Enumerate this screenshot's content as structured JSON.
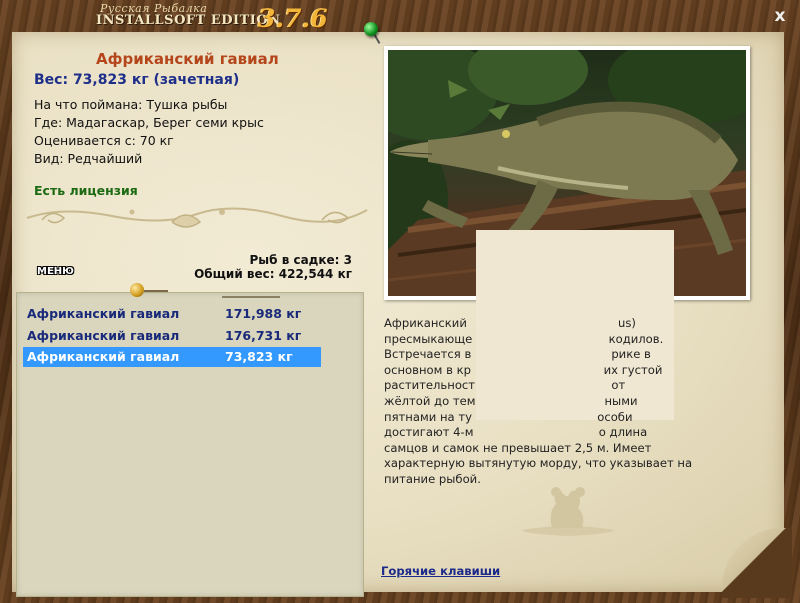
{
  "app": {
    "logo_small": "Русская Рыбалка",
    "logo_main": "INSTALLSOFT EDITION",
    "version": "3.7.6",
    "close_label": "x"
  },
  "fish": {
    "title": "Африканский гавиал",
    "weight": "Вес: 73,823 кг (зачетная)",
    "caught_with": "На что поймана: Тушка рыбы",
    "where": "Где: Мадагаскар, Берег семи крыс",
    "value": "Оценивается с: 70 кг",
    "kind": "Вид: Редчайший",
    "license": "Есть лицензия"
  },
  "stats": {
    "count": "Рыб в садке: 3",
    "total": "Общий вес: 422,544 кг"
  },
  "menu_label": "МЕНЮ",
  "list": [
    {
      "name": "Африканский гавиал",
      "weight": "171,988 кг",
      "selected": false
    },
    {
      "name": "Африканский гавиал",
      "weight": "176,731 кг",
      "selected": false
    },
    {
      "name": "Африканский гавиал",
      "weight": "73,823 кг",
      "selected": true
    }
  ],
  "description": [
    "Африканский                                         us)",
    "пресмыкающе                                     кодилов.",
    "Встречается в                                      рике в",
    "основном в кр                                    их густой",
    "растительност                                     от",
    "жёлтой до тем                                   ными",
    "пятнами на ту                                  особи",
    "достигают 4-м                                  о длина",
    "самцов и самок не превышает 2,5 м. Имеет",
    "характерную вытянутую морду, что указывает на",
    "питание рыбой."
  ],
  "hotkeys_label": "Горячие клавиши",
  "colors": {
    "title": "#b5451b",
    "weight": "#1e2f8a",
    "license": "#1c6a12",
    "selection": "#3399ff"
  }
}
